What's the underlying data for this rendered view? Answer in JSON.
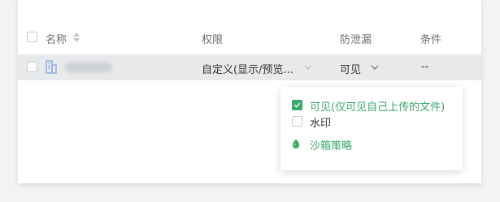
{
  "table": {
    "columns": {
      "name": "名称",
      "permission": "权限",
      "leak_prevention": "防泄漏",
      "condition": "条件"
    },
    "row": {
      "permission_value": "自定义(显示/预览...",
      "leak_prevention_value": "可见",
      "condition_value": "--"
    }
  },
  "dropdown": {
    "options": [
      {
        "label": "可见(仅可见自己上传的文件)",
        "checked": true
      },
      {
        "label": "水印",
        "checked": false
      }
    ],
    "sandbox_label": "沙箱策略"
  },
  "colors": {
    "accent": "#3aa86b",
    "row_highlight": "#e8e9eb"
  }
}
